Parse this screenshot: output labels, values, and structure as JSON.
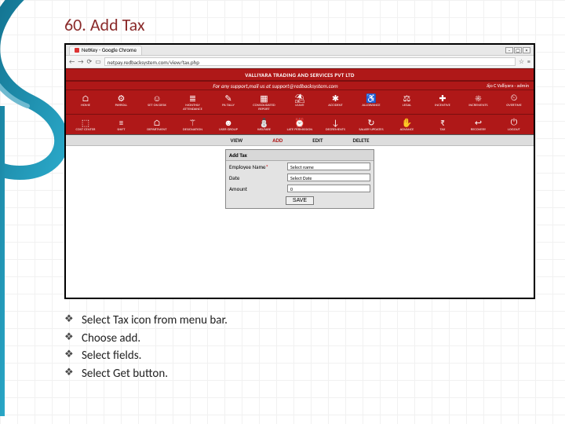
{
  "slide": {
    "title": "60. Add Tax"
  },
  "browser": {
    "tab_label": "NetKey - Google Chrome",
    "url": "netpay.redbacksystem.com/view/tax.php"
  },
  "page": {
    "company": "VALLIYARA TRADING AND SERVICES PVT LTD",
    "support_text": "For any support,mail us at support@redbacksystem.com",
    "user": "Jijo C Valliyara - admin"
  },
  "menu_row1": [
    {
      "icon": "⌂",
      "label": "HOME"
    },
    {
      "icon": "⚙",
      "label": "PAYROLL"
    },
    {
      "icon": "☺",
      "label": "SET ON DESK"
    },
    {
      "icon": "≣",
      "label": "MONTHLY ATTENDANCE"
    },
    {
      "icon": "✎",
      "label": "PA TALLY"
    },
    {
      "icon": "▦",
      "label": "CONSOLIDATED REPORT"
    },
    {
      "icon": "⛱",
      "label": "LEAVE"
    },
    {
      "icon": "✱",
      "label": "ACCIDENT"
    },
    {
      "icon": "♿",
      "label": "ALLOWANCE"
    },
    {
      "icon": "⚖",
      "label": "LEGAL"
    },
    {
      "icon": "✚",
      "label": "INCENTIVE"
    },
    {
      "icon": "☀",
      "label": "INCREMENTS"
    },
    {
      "icon": "⏲",
      "label": "OVERTIME"
    }
  ],
  "menu_row2": [
    {
      "icon": "⬚",
      "label": "COST CENTER"
    },
    {
      "icon": "≡",
      "label": "SHIFT"
    },
    {
      "icon": "⌂",
      "label": "DEPARTMENT"
    },
    {
      "icon": "⚚",
      "label": "DESIGNATION"
    },
    {
      "icon": "☻",
      "label": "USER GROUP"
    },
    {
      "icon": "⛄",
      "label": "WELFARE"
    },
    {
      "icon": "⏰",
      "label": "LATE PERMISSION"
    },
    {
      "icon": "↓",
      "label": "DECREMENTS"
    },
    {
      "icon": "↻",
      "label": "SALARY UPDATES"
    },
    {
      "icon": "✋",
      "label": "ADVANCE"
    },
    {
      "icon": "₹",
      "label": "TAX"
    },
    {
      "icon": "↩",
      "label": "RECOVERY"
    },
    {
      "icon": "⏻",
      "label": "LOGOUT"
    }
  ],
  "subtabs": {
    "view": "VIEW",
    "add": "ADD",
    "edit": "EDIT",
    "delete": "DELETE"
  },
  "form": {
    "title": "Add Tax",
    "employee_label": "Employee Name",
    "employee_value": "Select name",
    "date_label": "Date",
    "date_value": "Select Date",
    "amount_label": "Amount",
    "amount_value": "0",
    "save_label": "SAVE"
  },
  "bullets": [
    "Select Tax icon from menu bar.",
    "Choose add.",
    "Select fields.",
    "Select Get button."
  ]
}
